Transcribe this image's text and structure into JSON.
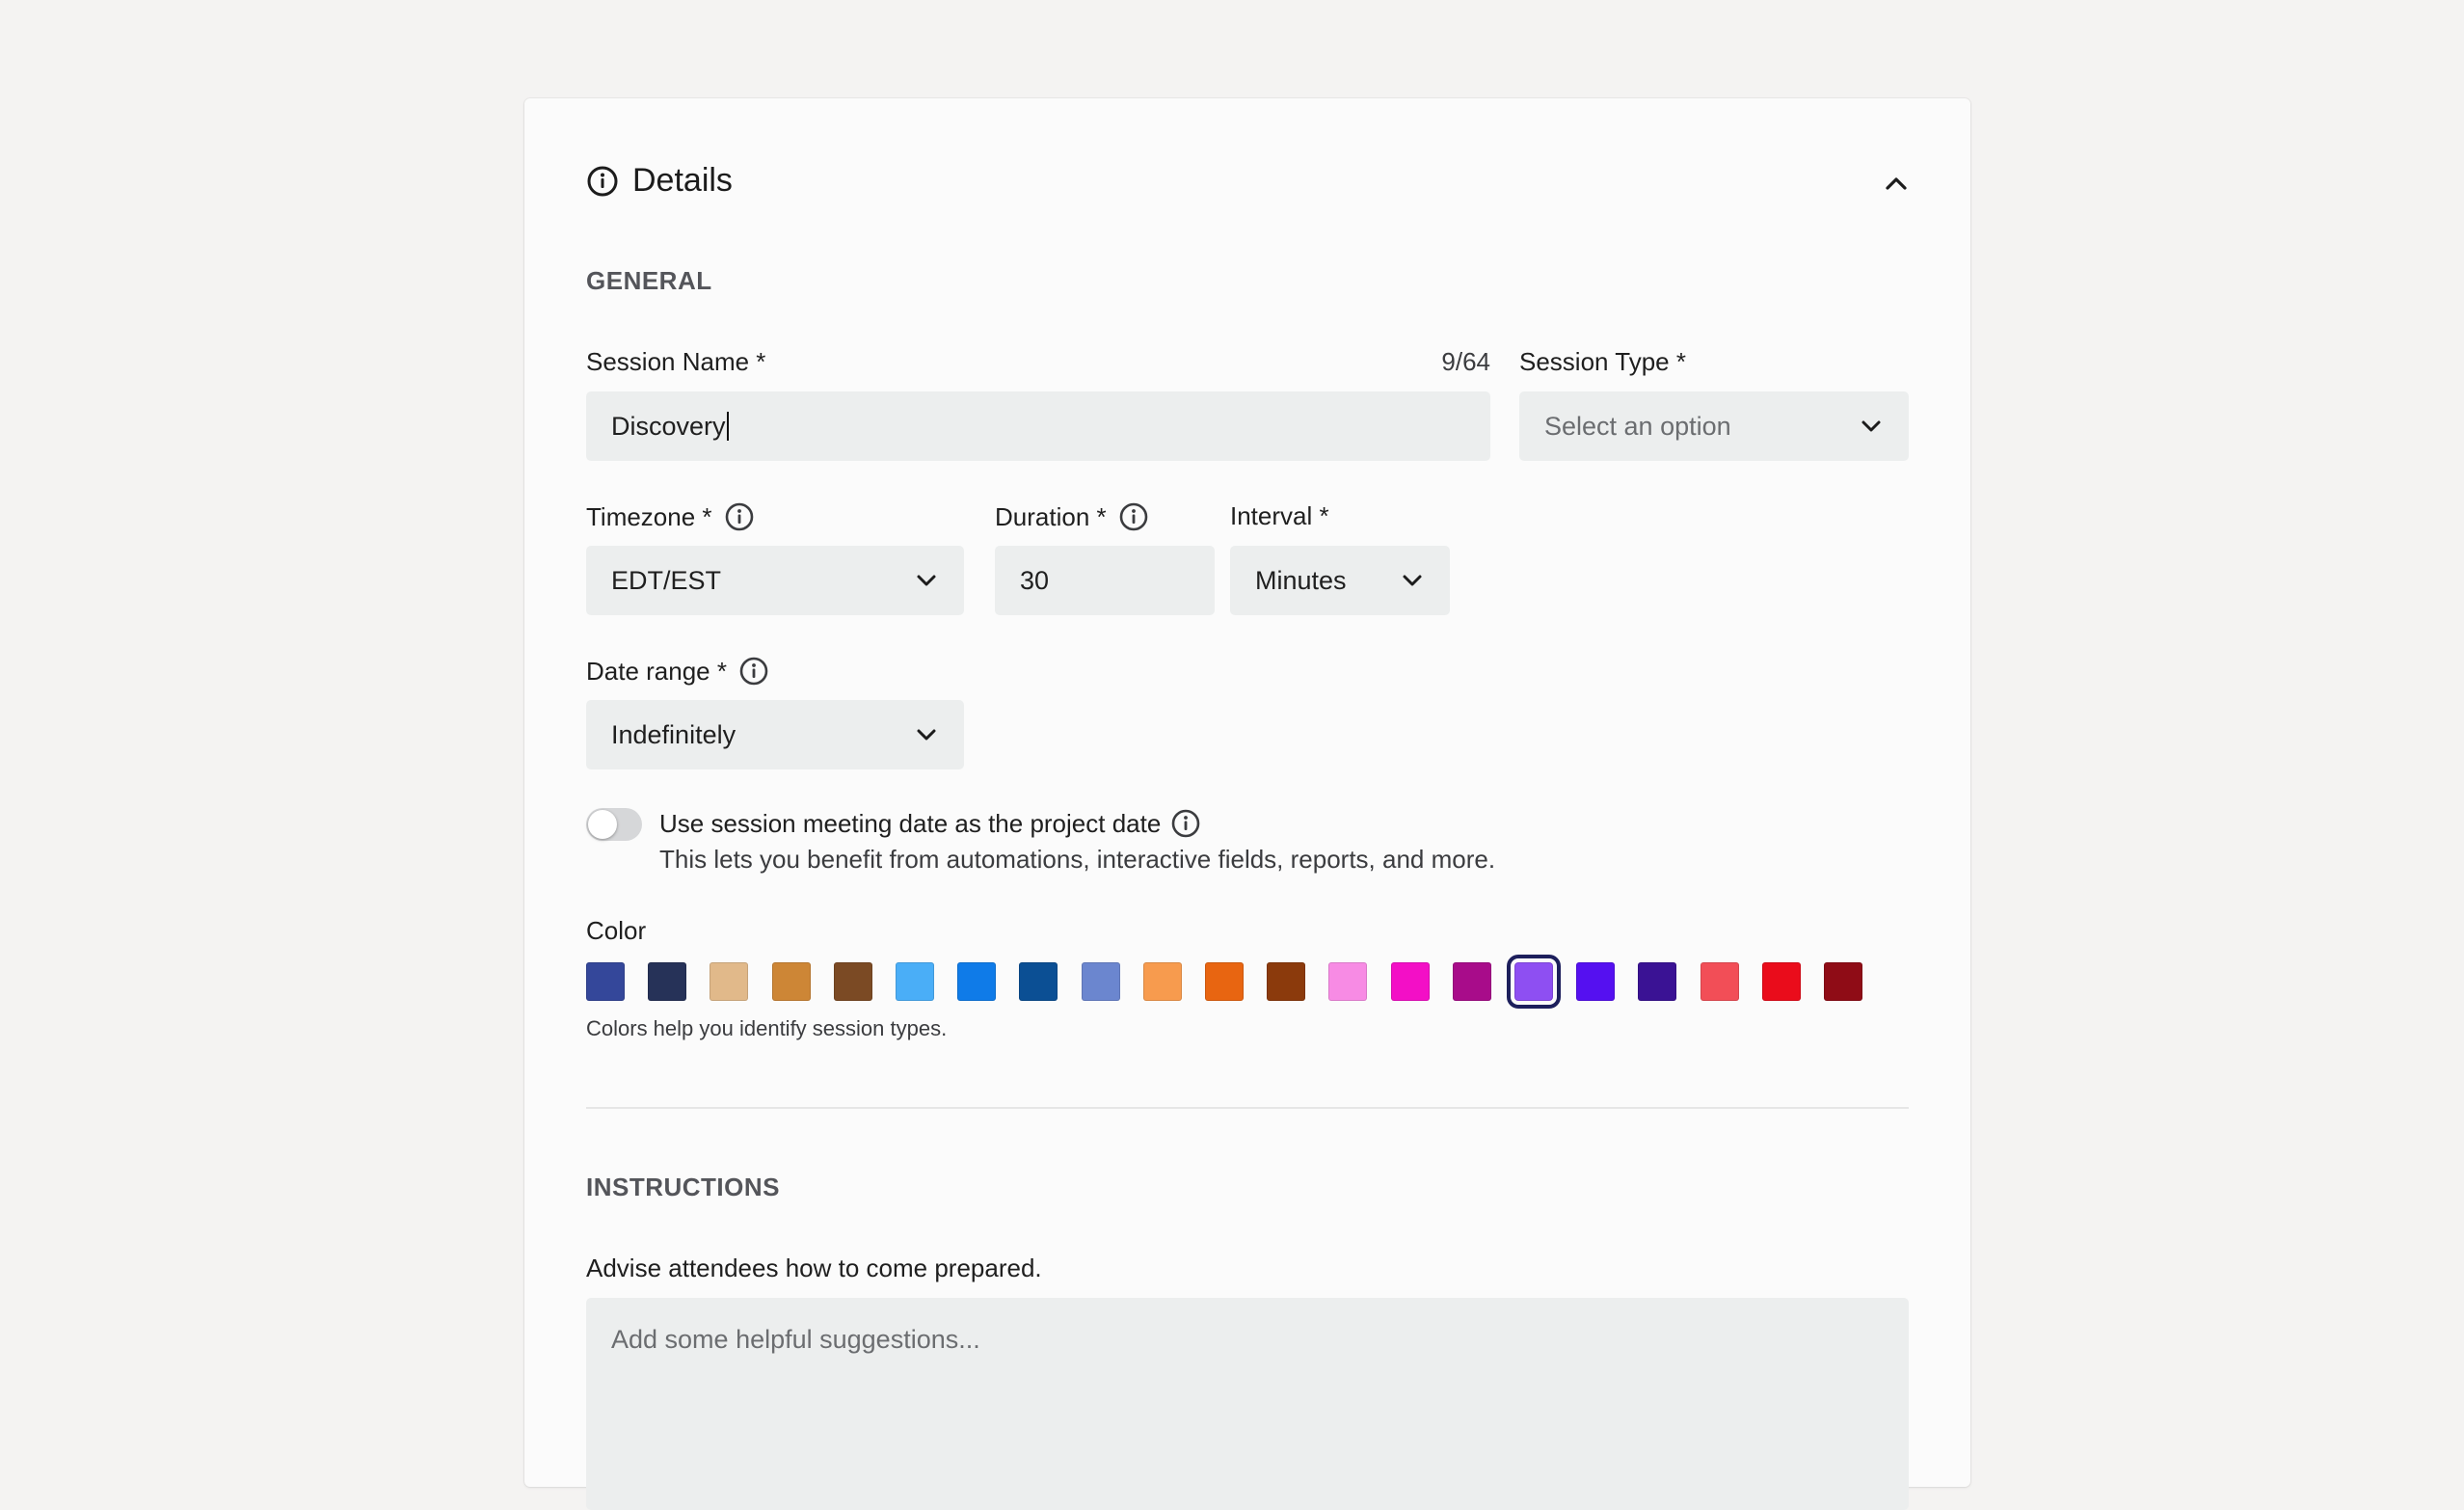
{
  "details": {
    "title": "Details",
    "general_heading": "GENERAL",
    "session_name": {
      "label": "Session Name *",
      "value": "Discovery",
      "counter": "9/64"
    },
    "session_type": {
      "label": "Session Type *",
      "placeholder": "Select an option"
    },
    "timezone": {
      "label": "Timezone *",
      "value": "EDT/EST"
    },
    "duration": {
      "label": "Duration *",
      "value": "30"
    },
    "interval": {
      "label": "Interval *",
      "value": "Minutes"
    },
    "date_range": {
      "label": "Date range *",
      "value": "Indefinitely"
    },
    "project_date_toggle": {
      "label": "Use session meeting date as the project date",
      "description": "This lets you benefit from automations, interactive fields, reports, and more.",
      "enabled": false
    },
    "color": {
      "label": "Color",
      "helper": "Colors help you identify session types.",
      "selected_index": 15,
      "swatches": [
        "#34479a",
        "#263258",
        "#e1b98a",
        "#cd8636",
        "#7b4a24",
        "#4aaef7",
        "#0f7be8",
        "#0b4f94",
        "#6b86cf",
        "#f79b4e",
        "#e86511",
        "#8b3a0c",
        "#f78be4",
        "#f30fc6",
        "#a80c8a",
        "#8e4ff2",
        "#5510f0",
        "#3a1294",
        "#f24e57",
        "#ea0c1b",
        "#8f0c16"
      ]
    },
    "instructions_heading": "INSTRUCTIONS",
    "instructions": {
      "label": "Advise attendees how to come prepared.",
      "placeholder": "Add some helpful suggestions..."
    }
  }
}
